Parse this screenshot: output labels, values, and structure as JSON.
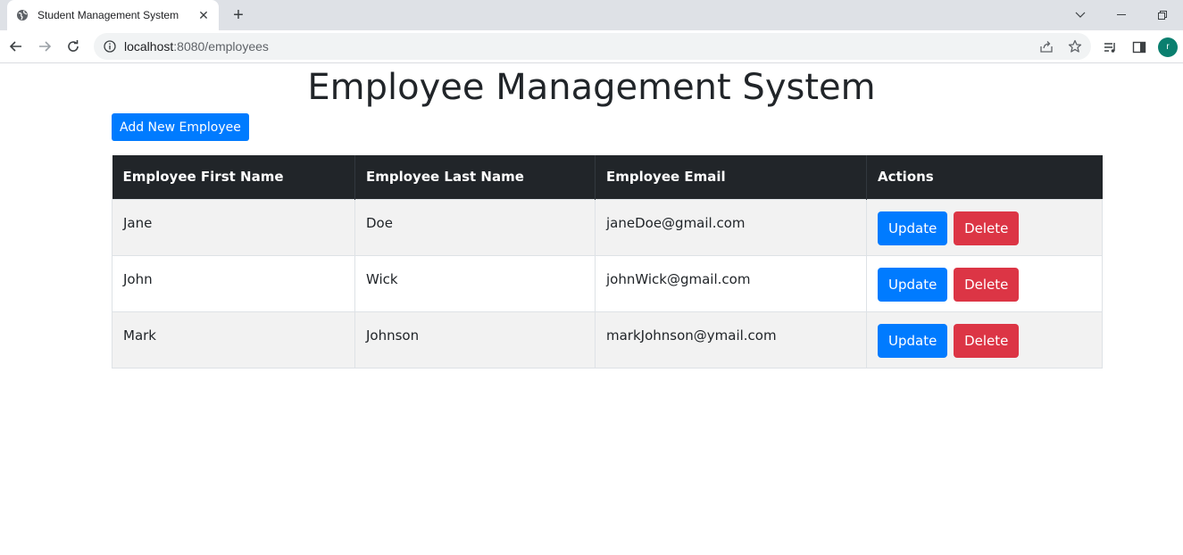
{
  "browser": {
    "tab_title": "Student Management System",
    "url_host": "localhost",
    "url_path": ":8080/employees",
    "avatar_letter": "r",
    "icons": {
      "favicon": "globe-icon",
      "close": "close-icon",
      "new_tab": "plus-icon",
      "back": "back-arrow-icon",
      "forward": "forward-arrow-icon",
      "reload": "reload-icon",
      "info": "info-icon",
      "share": "share-icon",
      "bookmark": "star-icon",
      "media": "media-icon",
      "side_panel": "side-panel-icon"
    }
  },
  "page": {
    "title": "Employee Management System",
    "add_button": "Add New Employee"
  },
  "table": {
    "headers": [
      "Employee First Name",
      "Employee Last Name",
      "Employee Email",
      "Actions"
    ],
    "rows": [
      {
        "first": "Jane",
        "last": "Doe",
        "email": "janeDoe@gmail.com"
      },
      {
        "first": "John",
        "last": "Wick",
        "email": "johnWick@gmail.com"
      },
      {
        "first": "Mark",
        "last": "Johnson",
        "email": "markJohnson@ymail.com"
      }
    ],
    "update_label": "Update",
    "delete_label": "Delete"
  },
  "colors": {
    "primary": "#007bff",
    "danger": "#dc3545",
    "header_bg": "#212529",
    "avatar": "#0a7f6f"
  }
}
